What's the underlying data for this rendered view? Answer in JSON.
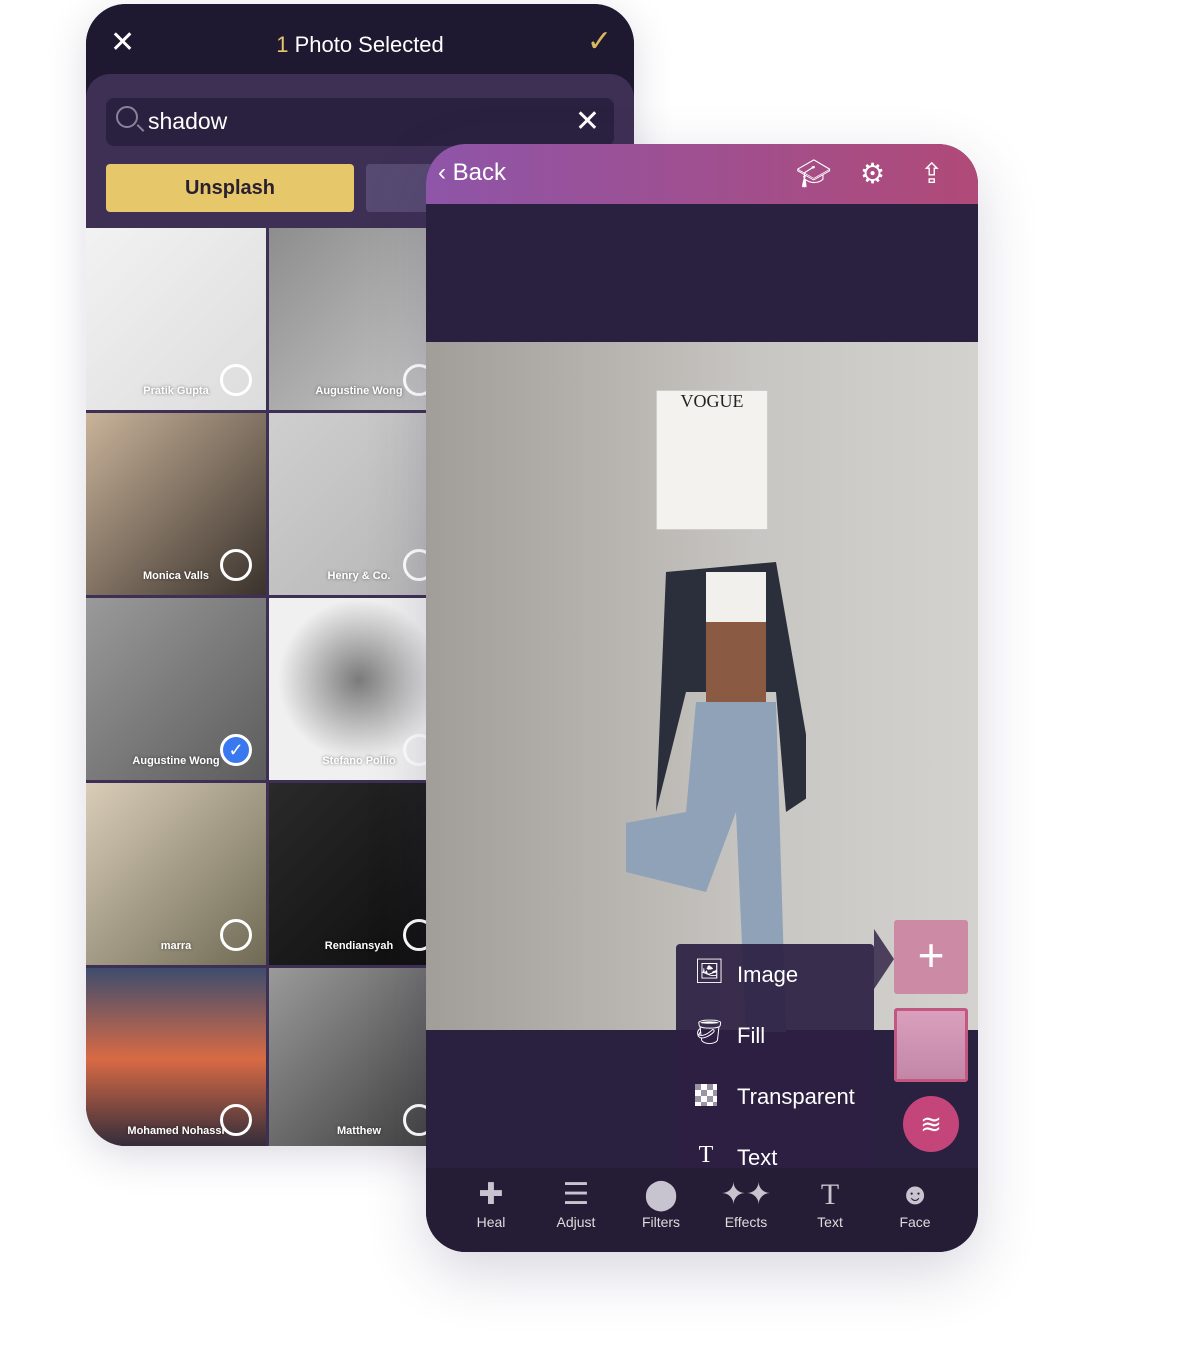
{
  "picker": {
    "title_count": "1",
    "title_text": "Photo Selected",
    "search_value": "shadow",
    "tabs": [
      "Unsplash",
      ""
    ],
    "photos": [
      {
        "author": "Pratik Gupta",
        "selected": false,
        "bg": "linear-gradient(135deg,#f2f2f2,#dcdcdc)"
      },
      {
        "author": "Augustine Wong",
        "selected": false,
        "bg": "linear-gradient(135deg,#8d8d8d,#c9c9c9)"
      },
      {
        "author": "Monica Valls",
        "selected": false,
        "bg": "linear-gradient(135deg,#c9b39a,#3a322c)"
      },
      {
        "author": "Henry & Co.",
        "selected": false,
        "bg": "linear-gradient(135deg,#cfcfcf,#b5b5b5)"
      },
      {
        "author": "Augustine Wong",
        "selected": true,
        "bg": "linear-gradient(135deg,#9a9a9a,#5c5c5c)"
      },
      {
        "author": "Stefano Pollio",
        "selected": false,
        "bg": "radial-gradient(circle at 50% 45%,#7a7a7a,#f0f0f0 60%)"
      },
      {
        "author": "marra",
        "selected": false,
        "bg": "linear-gradient(135deg,#d9cdb8,#6f6a55)"
      },
      {
        "author": "Rendiansyah",
        "selected": false,
        "bg": "linear-gradient(135deg,#2a2a2a,#0c0c0c)"
      },
      {
        "author": "Mohamed Nohassi",
        "selected": false,
        "bg": "linear-gradient(#3e4d6e,#d86a45 50%,#2c2a3a)"
      },
      {
        "author": "Matthew",
        "selected": false,
        "bg": "linear-gradient(135deg,#9a9a9a,#3a3a3a)"
      }
    ]
  },
  "editor": {
    "back_label": "Back",
    "magazine": "VOGUE",
    "menu": [
      {
        "label": "Image",
        "icon": "image-icon"
      },
      {
        "label": "Fill",
        "icon": "paint-bucket-icon"
      },
      {
        "label": "Transparent",
        "icon": "checkerboard-icon"
      },
      {
        "label": "Text",
        "icon": "text-icon"
      }
    ],
    "tools": [
      {
        "label": "Heal",
        "icon": "bandage-icon"
      },
      {
        "label": "Adjust",
        "icon": "sliders-icon"
      },
      {
        "label": "Filters",
        "icon": "filters-icon"
      },
      {
        "label": "Effects",
        "icon": "sparkles-icon"
      },
      {
        "label": "Text",
        "icon": "text-icon"
      },
      {
        "label": "Face",
        "icon": "face-icon"
      }
    ],
    "accent": "#c4457a"
  }
}
